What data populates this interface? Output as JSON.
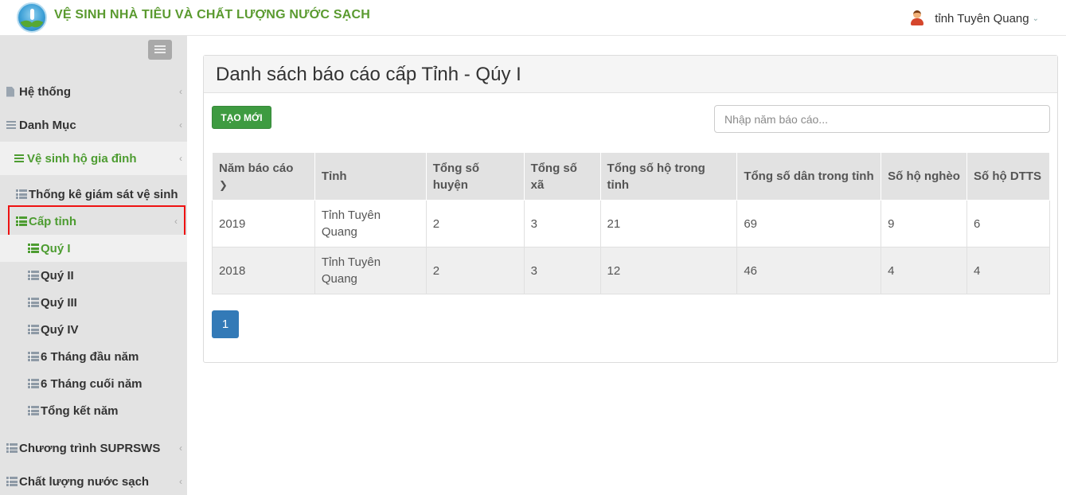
{
  "header": {
    "title": "VỆ SINH NHÀ TIÊU VÀ CHẤT LƯỢNG NƯỚC SẠCH",
    "user_name": "tỉnh Tuyên Quang"
  },
  "sidebar": {
    "items": [
      {
        "label": "Hệ thống",
        "icon": "file-icon"
      },
      {
        "label": "Danh Mục",
        "icon": "list-icon"
      },
      {
        "label": "Vệ sinh hộ gia đình",
        "icon": "list-icon",
        "active": true
      },
      {
        "label": "Thống kê giám sát vệ sinh",
        "icon": "table-icon"
      },
      {
        "label": "Cấp tỉnh",
        "icon": "table-icon",
        "active": true
      },
      {
        "label": "Quý I",
        "icon": "table-icon",
        "active": true
      },
      {
        "label": "Quý II",
        "icon": "table-icon"
      },
      {
        "label": "Quý III",
        "icon": "table-icon"
      },
      {
        "label": "Quý IV",
        "icon": "table-icon"
      },
      {
        "label": "6 Tháng đầu năm",
        "icon": "table-icon"
      },
      {
        "label": "6 Tháng cuối năm",
        "icon": "table-icon"
      },
      {
        "label": "Tổng kết năm",
        "icon": "table-icon"
      },
      {
        "label": "Chương trình SUPRSWS",
        "icon": "table-icon"
      },
      {
        "label": "Chất lượng nước sạch",
        "icon": "table-icon"
      }
    ]
  },
  "main": {
    "title": "Danh sách báo cáo cấp Tỉnh - Qúy I",
    "new_button": "TẠO MỚI",
    "search_placeholder": "Nhập năm báo cáo...",
    "table": {
      "headers": [
        {
          "line1": "Năm báo cáo",
          "line2": ""
        },
        {
          "line1": "Tỉnh",
          "line2": ""
        },
        {
          "line1": "Tổng số",
          "line2": "huyện"
        },
        {
          "line1": "Tổng số",
          "line2": "xã"
        },
        {
          "line1": "Tổng số hộ trong tỉnh",
          "line2": ""
        },
        {
          "line1": "Tổng số dân trong tỉnh",
          "line2": ""
        },
        {
          "line1": "Số hộ nghèo",
          "line2": ""
        },
        {
          "line1": "Số hộ DTTS",
          "line2": ""
        }
      ],
      "rows": [
        {
          "nam": "2019",
          "tinh1": "Tỉnh Tuyên",
          "tinh2": "Quang",
          "huyen": "2",
          "xa": "3",
          "ho": "21",
          "dan": "69",
          "ngheo": "9",
          "dtts": "6"
        },
        {
          "nam": "2018",
          "tinh1": "Tỉnh Tuyên",
          "tinh2": "Quang",
          "huyen": "2",
          "xa": "3",
          "ho": "12",
          "dan": "46",
          "ngheo": "4",
          "dtts": "4"
        }
      ]
    },
    "pagination": {
      "current_page": "1"
    }
  },
  "colors": {
    "brand_green": "#4d9c31",
    "page_blue": "#337ab7",
    "button_green": "#3e9b41",
    "highlight_red": "#ee1111"
  }
}
